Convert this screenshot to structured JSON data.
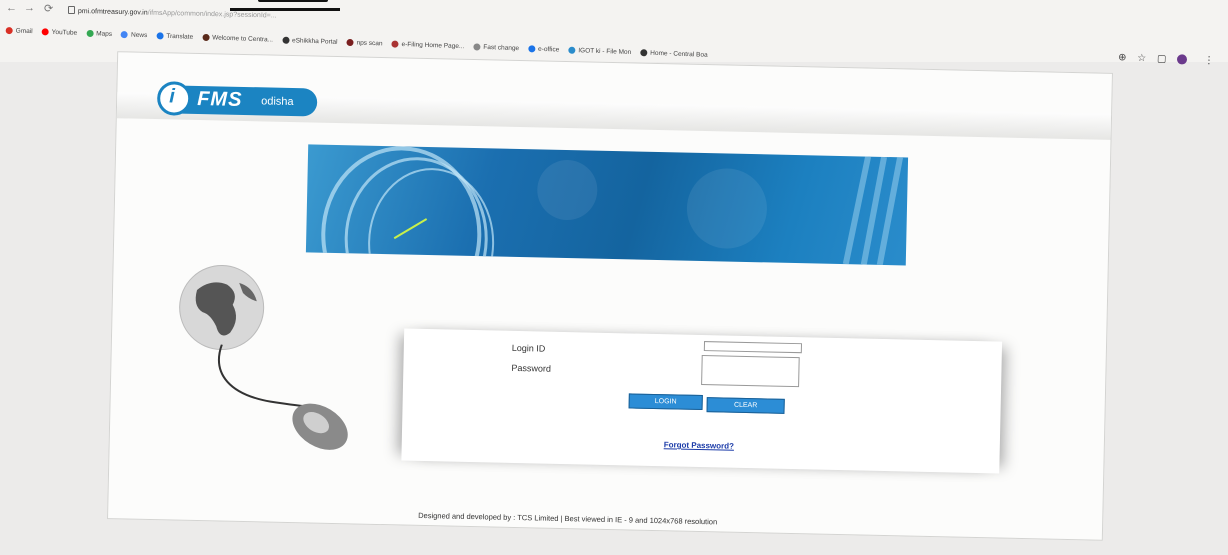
{
  "browser": {
    "url_host": "pmi.ofmtreasury.gov.in",
    "url_path": "/ifmsApp/common/index.jsp?sessionId=...",
    "bookmarks": [
      {
        "label": "Gmail",
        "color": "#d93025"
      },
      {
        "label": "YouTube",
        "color": "#ff0000"
      },
      {
        "label": "Maps",
        "color": "#34a853"
      },
      {
        "label": "News",
        "color": "#4285f4"
      },
      {
        "label": "Translate",
        "color": "#1a73e8"
      },
      {
        "label": "Welcome to Centra...",
        "color": "#5a2a1a"
      },
      {
        "label": "eShikkha Portal",
        "color": "#333333"
      },
      {
        "label": "nps scan",
        "color": "#7a1f1f"
      },
      {
        "label": "e-Filing Home Page...",
        "color": "#a33"
      },
      {
        "label": "Fast change",
        "color": "#888888"
      },
      {
        "label": "e-office",
        "color": "#1a73e8"
      },
      {
        "label": "IGOT ki - File Mon",
        "color": "#2a8ccb"
      },
      {
        "label": "Home - Central Boa",
        "color": "#333333"
      }
    ]
  },
  "app": {
    "logo_text": "FMS",
    "logo_sub": "odisha",
    "login_label": "Login ID",
    "password_label": "Password",
    "login_value": "",
    "password_value": "",
    "login_button": "LOGIN",
    "clear_button": "CLEAR",
    "forgot_link": "Forgot Password?",
    "footer": "Designed and developed by : TCS Limited | Best viewed in IE - 9 and 1024x768 resolution"
  },
  "colors": {
    "brand": "#1b84c2",
    "button": "#2c8dd6"
  }
}
